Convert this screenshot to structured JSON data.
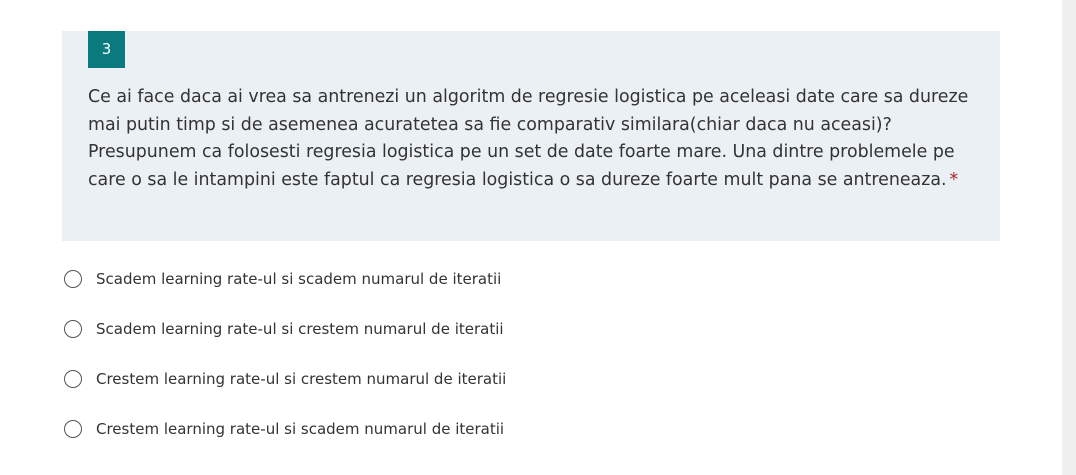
{
  "question": {
    "number": "3",
    "text": "Ce ai face daca ai vrea sa antrenezi un algoritm de regresie logistica pe aceleasi date care sa dureze mai putin timp si de asemenea acuratetea sa fie comparativ similara(chiar daca nu aceasi)? Presupunem ca folosesti regresia logistica pe un set de date foarte mare. Una dintre problemele pe care o sa le intampini este faptul ca regresia logistica o sa dureze foarte mult pana se antreneaza.",
    "required_marker": "*"
  },
  "options": [
    {
      "label": "Scadem learning rate-ul si scadem numarul de iteratii"
    },
    {
      "label": "Scadem learning rate-ul si crestem numarul de iteratii"
    },
    {
      "label": "Crestem learning rate-ul si crestem numarul de iteratii"
    },
    {
      "label": "Crestem learning rate-ul si scadem numarul de iteratii"
    }
  ],
  "colors": {
    "accent": "#0a7a7e",
    "question_background": "#eaf0f3",
    "required": "#a4262c",
    "text": "#333333"
  }
}
